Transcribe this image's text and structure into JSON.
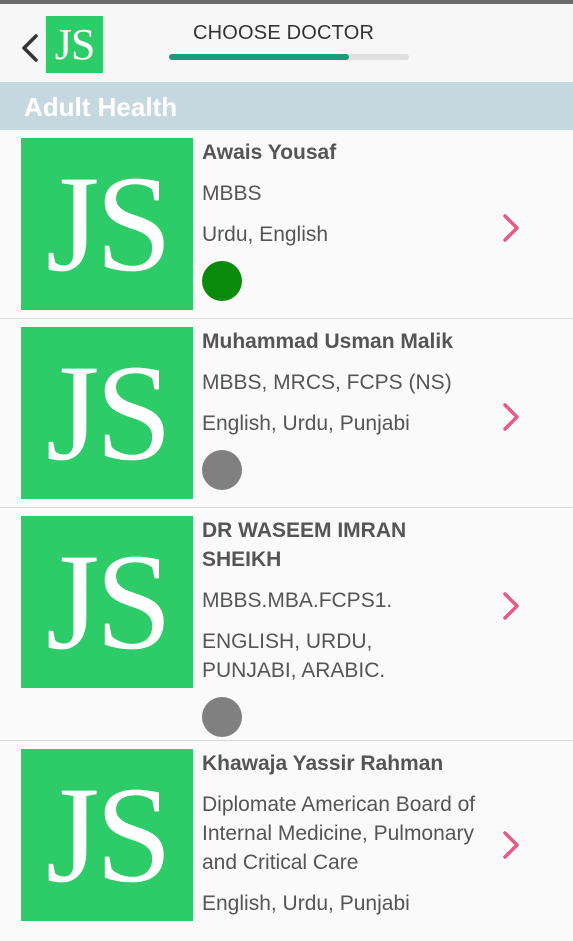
{
  "header": {
    "title": "CHOOSE DOCTOR",
    "logo_text": "JS",
    "progress_fraction": 0.75
  },
  "section": {
    "title": "Adult Health"
  },
  "colors": {
    "brand_green": "#2ecc68",
    "accent_pink": "#e85a85",
    "online": "#0a8a0a",
    "offline": "#808080",
    "progress": "#1a9b79"
  },
  "doctors": [
    {
      "name": "Awais Yousaf",
      "qualification": "MBBS",
      "languages": "Urdu, English",
      "status": "online",
      "avatar_text": "JS"
    },
    {
      "name": "Muhammad Usman Malik",
      "qualification": "MBBS, MRCS, FCPS (NS)",
      "languages": "English, Urdu, Punjabi",
      "status": "offline",
      "avatar_text": "JS"
    },
    {
      "name": "DR WASEEM IMRAN SHEIKH",
      "qualification": "MBBS.MBA.FCPS1.",
      "languages": "ENGLISH, URDU, PUNJABI, ARABIC.",
      "status": "offline",
      "avatar_text": "JS"
    },
    {
      "name": "Khawaja Yassir Rahman",
      "qualification": "Diplomate American Board of Internal Medicine, Pulmonary and Critical Care",
      "languages": "English, Urdu, Punjabi",
      "status": "offline",
      "avatar_text": "JS"
    }
  ]
}
